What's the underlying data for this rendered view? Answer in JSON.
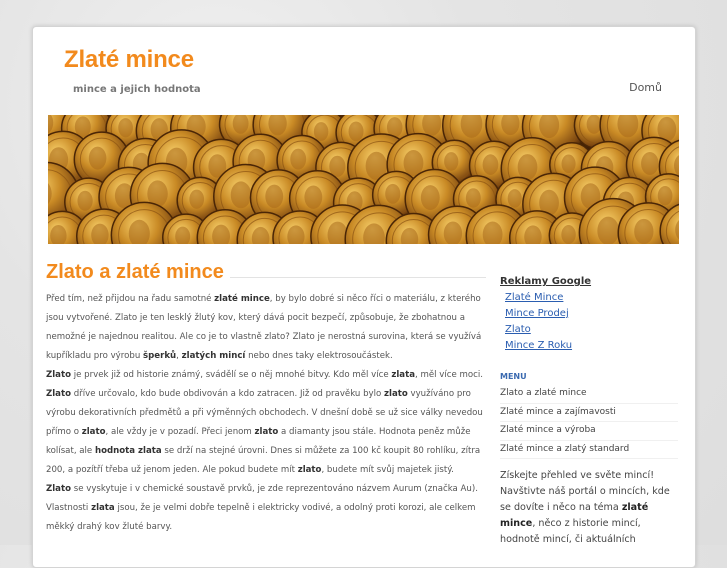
{
  "header": {
    "site_title": "Zlaté mince",
    "site_description": "mince a jejich hodnota",
    "nav_home": "Domů"
  },
  "banner": {
    "image": "gold coins photograph"
  },
  "post": {
    "title": "Zlato a zlaté mince",
    "paragraphs": [
      {
        "parts": [
          {
            "t": "Před tím, než přijdou na řadu samotné "
          },
          {
            "b": "zlaté mince"
          },
          {
            "t": ", by bylo dobré si něco říci o materiálu, z kterého jsou vytvořené. Zlato je ten lesklý žlutý kov, který dává pocit bezpečí, způsobuje, že zbohatnou a nemožné je najednou realitou. Ale co je to vlastně zlato? Zlato je nerostná surovina, která se využívá kupříkladu pro výrobu "
          },
          {
            "b": "šperků"
          },
          {
            "t": ", "
          },
          {
            "b": "zlatých mincí"
          },
          {
            "t": " nebo dnes taky elektrosoučástek."
          }
        ]
      },
      {
        "parts": [
          {
            "b": "Zlato"
          },
          {
            "t": " je prvek již od historie známý, svádělí se o něj mnohé bitvy. Kdo měl více "
          },
          {
            "b": "zlata"
          },
          {
            "t": ", měl více moci."
          }
        ]
      },
      {
        "parts": [
          {
            "b": "Zlato"
          },
          {
            "t": " dříve určovalo, kdo bude obdivován a kdo zatracen. Již od pravěku bylo "
          },
          {
            "b": "zlato"
          },
          {
            "t": " využíváno pro výrobu dekorativních předmětů a při výměnných obchodech. V dnešní době se už sice války nevedou přímo o "
          },
          {
            "b": "zlato"
          },
          {
            "t": ", ale vždy je v pozadí. Přeci jenom "
          },
          {
            "b": "zlato"
          },
          {
            "t": " a diamanty jsou stále. Hodnota peněz může kolísat, ale "
          },
          {
            "b": "hodnota zlata"
          },
          {
            "t": " se drží na stejné úrovni. Dnes si můžete za 100 kč koupit 80 rohlíku, zítra 200, a pozítří třeba už jenom jeden. Ale pokud budete mít "
          },
          {
            "b": "zlato"
          },
          {
            "t": ", budete mít svůj majetek jistý."
          }
        ]
      },
      {
        "parts": [
          {
            "b": "Zlato"
          },
          {
            "t": " se vyskytuje i v chemické soustavě prvků, je zde reprezentováno názvem Aurum (značka Au). Vlastnosti "
          },
          {
            "b": "zlata"
          },
          {
            "t": " jsou, že je velmi dobře tepelně i elektricky vodivé, a odolný proti korozi, ale celkem měkký drahý kov žluté barvy."
          }
        ]
      }
    ]
  },
  "sidebar": {
    "ads_title": "Reklamy Google",
    "ads": [
      "Zlaté Mince",
      "Mince Prodej",
      "Zlato",
      "Mince Z Roku"
    ],
    "menu_title": "MENU",
    "menu": [
      "Zlato a zlaté mince",
      "Zlaté mince a zajímavosti",
      "Zlaté mince a výroba",
      "Zlaté mince a zlatý standard"
    ],
    "promo_parts": [
      {
        "t": "Získejte přehled ve světe mincí! Navštivte náš portál o mincích, kde se dovíte i něco na téma "
      },
      {
        "b": "zlaté mince"
      },
      {
        "t": ", něco z historie mincí, hodnotě mincí, či aktuálních"
      }
    ]
  },
  "colors": {
    "accent": "#f28a1d",
    "link": "#2a5db0",
    "menu_title": "#3b6ab0"
  }
}
